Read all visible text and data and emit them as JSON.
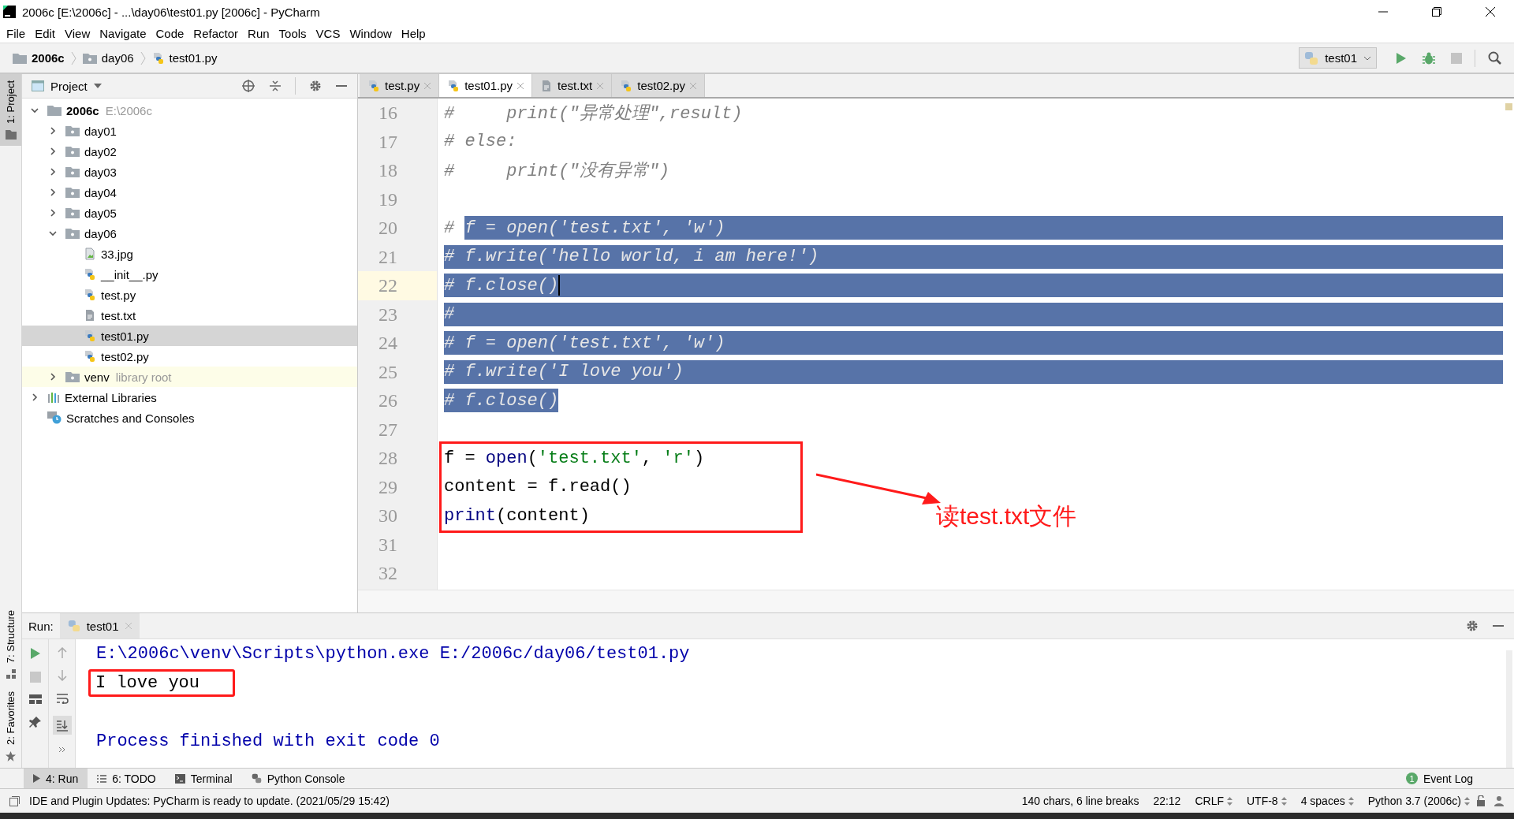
{
  "window": {
    "title": "2006c [E:\\2006c] - ...\\day06\\test01.py [2006c] - PyCharm"
  },
  "menu": [
    "File",
    "Edit",
    "View",
    "Navigate",
    "Code",
    "Refactor",
    "Run",
    "Tools",
    "VCS",
    "Window",
    "Help"
  ],
  "breadcrumbs": [
    {
      "label": "2006c",
      "kind": "root"
    },
    {
      "label": "day06",
      "kind": "folder"
    },
    {
      "label": "test01.py",
      "kind": "python"
    }
  ],
  "run_config": {
    "label": "test01"
  },
  "side_tabs_top": [
    {
      "label": "1: Project",
      "selected": true
    }
  ],
  "side_tabs_bottom": [
    {
      "label": "7: Structure",
      "selected": false,
      "kind": "structure"
    },
    {
      "label": "2: Favorites",
      "selected": false,
      "kind": "favorites"
    }
  ],
  "project": {
    "title": "Project",
    "tree": [
      {
        "name": "2006c",
        "hint": "E:\\2006c",
        "kind": "root",
        "expanded": true,
        "selected": false,
        "children": [
          {
            "name": "day01",
            "kind": "folder",
            "expanded": false,
            "selected": false
          },
          {
            "name": "day02",
            "kind": "folder",
            "expanded": false,
            "selected": false
          },
          {
            "name": "day03",
            "kind": "folder",
            "expanded": false,
            "selected": false
          },
          {
            "name": "day04",
            "kind": "folder",
            "expanded": false,
            "selected": false
          },
          {
            "name": "day05",
            "kind": "folder",
            "expanded": false,
            "selected": false
          },
          {
            "name": "day06",
            "kind": "folder",
            "expanded": true,
            "selected": false,
            "children": [
              {
                "name": "33.jpg",
                "kind": "image",
                "selected": false
              },
              {
                "name": "__init__.py",
                "kind": "python",
                "selected": false
              },
              {
                "name": "test.py",
                "kind": "python",
                "selected": false
              },
              {
                "name": "test.txt",
                "kind": "text",
                "selected": false
              },
              {
                "name": "test01.py",
                "kind": "python",
                "selected": true
              },
              {
                "name": "test02.py",
                "kind": "python",
                "selected": false
              }
            ]
          },
          {
            "name": "venv",
            "hint": "library root",
            "kind": "library",
            "expanded": false,
            "selected": false
          }
        ]
      },
      {
        "name": "External Libraries",
        "kind": "libraries",
        "expanded": false,
        "selected": false
      },
      {
        "name": "Scratches and Consoles",
        "kind": "scratches",
        "selected": false
      }
    ]
  },
  "editor_tabs": [
    {
      "label": "test.py",
      "kind": "python",
      "selected": false
    },
    {
      "label": "test01.py",
      "kind": "python",
      "selected": true
    },
    {
      "label": "test.txt",
      "kind": "text",
      "selected": false
    },
    {
      "label": "test02.py",
      "kind": "python",
      "selected": false
    }
  ],
  "code_lines": [
    {
      "number": "16",
      "current": false,
      "selected": false,
      "selected_to_end": false,
      "segments": [
        {
          "text": "#     print(\"异常处理\",result)",
          "kind": "comment"
        }
      ]
    },
    {
      "number": "17",
      "current": false,
      "selected": false,
      "selected_to_end": false,
      "segments": [
        {
          "text": "# else:",
          "kind": "comment"
        }
      ]
    },
    {
      "number": "18",
      "current": false,
      "selected": false,
      "selected_to_end": false,
      "segments": [
        {
          "text": "#     print(\"没有异常\")",
          "kind": "comment"
        }
      ]
    },
    {
      "number": "19",
      "current": false,
      "selected_to_end": false
    },
    {
      "number": "20",
      "current": false,
      "selected": true,
      "selected_to_end": true,
      "prefix": "# ",
      "segments": [
        {
          "text": "f = open('test.txt', 'w')",
          "kind": "comment"
        }
      ]
    },
    {
      "number": "21",
      "current": false,
      "selected": true,
      "selected_to_end": true,
      "segments": [
        {
          "text": "# f.write('hello world, i am here!')",
          "kind": "comment"
        }
      ]
    },
    {
      "number": "22",
      "current": true,
      "selected": true,
      "selected_to_end": true,
      "segments": [
        {
          "text": "# f.close()",
          "kind": "comment"
        }
      ]
    },
    {
      "number": "23",
      "current": false,
      "selected": true,
      "selected_to_end": true,
      "segments": [
        {
          "text": "#",
          "kind": "comment"
        }
      ]
    },
    {
      "number": "24",
      "current": false,
      "selected": true,
      "selected_to_end": true,
      "segments": [
        {
          "text": "# f = open('test.txt', 'w')",
          "kind": "comment"
        }
      ]
    },
    {
      "number": "25",
      "current": false,
      "selected": true,
      "selected_to_end": true,
      "segments": [
        {
          "text": "# f.write('I love you')",
          "kind": "comment"
        }
      ]
    },
    {
      "number": "26",
      "current": false,
      "selected": true,
      "selected_to_end": false,
      "segments": [
        {
          "text": "# f.close()",
          "kind": "comment"
        }
      ]
    },
    {
      "number": "27",
      "current": false,
      "selected_to_end": false
    }
  ],
  "boxed_lines": [
    {
      "number": "28",
      "current": false,
      "segments": [
        {
          "text": "f = ",
          "kind": "plain"
        },
        {
          "text": "open",
          "kind": "builtin"
        },
        {
          "text": "(",
          "kind": "plain"
        },
        {
          "text": "'test.txt'",
          "kind": "string"
        },
        {
          "text": ", ",
          "kind": "plain"
        },
        {
          "text": "'r'",
          "kind": "string"
        },
        {
          "text": ")",
          "kind": "plain"
        }
      ]
    },
    {
      "number": "29",
      "current": false,
      "segments": [
        {
          "text": "content = f.read()",
          "kind": "plain"
        }
      ]
    },
    {
      "number": "30",
      "current": false,
      "segments": [
        {
          "text": "print",
          "kind": "builtin"
        },
        {
          "text": "(content)",
          "kind": "plain"
        }
      ]
    }
  ],
  "code_lines_end": [
    {
      "number": "31",
      "current": false
    },
    {
      "number": "32",
      "current": false
    }
  ],
  "annotation": {
    "label": "读test.txt文件"
  },
  "run": {
    "label": "Run:",
    "tab": "test01",
    "output": [
      {
        "text": "E:\\2006c\\venv\\Scripts\\python.exe E:/2006c/day06/test01.py",
        "kind": "command",
        "boxed": false
      },
      {
        "text": "I love you",
        "kind": "output",
        "boxed": true
      },
      {
        "text": "Process finished with exit code 0",
        "kind": "status",
        "boxed": false
      }
    ]
  },
  "tool_tabs": [
    {
      "label": "4: Run",
      "kind": "run",
      "selected": true
    },
    {
      "label": "6: TODO",
      "kind": "todo",
      "selected": false
    },
    {
      "label": "Terminal",
      "kind": "terminal",
      "selected": false
    },
    {
      "label": "Python Console",
      "kind": "console",
      "selected": false
    }
  ],
  "event_log": {
    "label": "Event Log",
    "count": "1"
  },
  "status_bar": {
    "message": "IDE and Plugin Updates: PyCharm is ready to update. (2021/05/29 15:42)",
    "items": [
      {
        "label": "140 chars, 6 line breaks",
        "dropdown": false
      },
      {
        "label": "22:12",
        "dropdown": false
      },
      {
        "label": "CRLF",
        "dropdown": true
      },
      {
        "label": "UTF-8",
        "dropdown": true
      },
      {
        "label": "4 spaces",
        "dropdown": true
      },
      {
        "label": "Python 3.7 (2006c)",
        "dropdown": true
      }
    ]
  }
}
